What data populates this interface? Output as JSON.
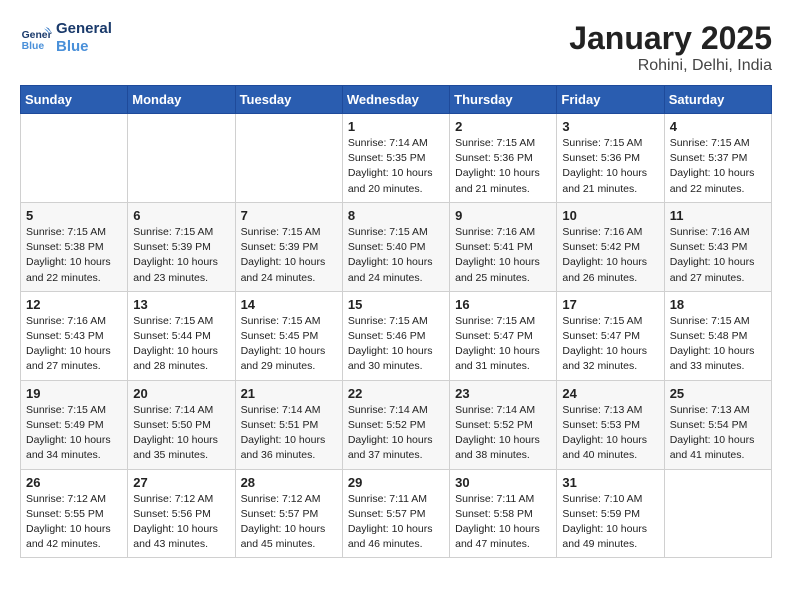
{
  "logo": {
    "line1": "General",
    "line2": "Blue"
  },
  "title": "January 2025",
  "location": "Rohini, Delhi, India",
  "weekdays": [
    "Sunday",
    "Monday",
    "Tuesday",
    "Wednesday",
    "Thursday",
    "Friday",
    "Saturday"
  ],
  "weeks": [
    [
      {
        "day": "",
        "sunrise": "",
        "sunset": "",
        "daylight": ""
      },
      {
        "day": "",
        "sunrise": "",
        "sunset": "",
        "daylight": ""
      },
      {
        "day": "",
        "sunrise": "",
        "sunset": "",
        "daylight": ""
      },
      {
        "day": "1",
        "sunrise": "Sunrise: 7:14 AM",
        "sunset": "Sunset: 5:35 PM",
        "daylight": "Daylight: 10 hours and 20 minutes."
      },
      {
        "day": "2",
        "sunrise": "Sunrise: 7:15 AM",
        "sunset": "Sunset: 5:36 PM",
        "daylight": "Daylight: 10 hours and 21 minutes."
      },
      {
        "day": "3",
        "sunrise": "Sunrise: 7:15 AM",
        "sunset": "Sunset: 5:36 PM",
        "daylight": "Daylight: 10 hours and 21 minutes."
      },
      {
        "day": "4",
        "sunrise": "Sunrise: 7:15 AM",
        "sunset": "Sunset: 5:37 PM",
        "daylight": "Daylight: 10 hours and 22 minutes."
      }
    ],
    [
      {
        "day": "5",
        "sunrise": "Sunrise: 7:15 AM",
        "sunset": "Sunset: 5:38 PM",
        "daylight": "Daylight: 10 hours and 22 minutes."
      },
      {
        "day": "6",
        "sunrise": "Sunrise: 7:15 AM",
        "sunset": "Sunset: 5:39 PM",
        "daylight": "Daylight: 10 hours and 23 minutes."
      },
      {
        "day": "7",
        "sunrise": "Sunrise: 7:15 AM",
        "sunset": "Sunset: 5:39 PM",
        "daylight": "Daylight: 10 hours and 24 minutes."
      },
      {
        "day": "8",
        "sunrise": "Sunrise: 7:15 AM",
        "sunset": "Sunset: 5:40 PM",
        "daylight": "Daylight: 10 hours and 24 minutes."
      },
      {
        "day": "9",
        "sunrise": "Sunrise: 7:16 AM",
        "sunset": "Sunset: 5:41 PM",
        "daylight": "Daylight: 10 hours and 25 minutes."
      },
      {
        "day": "10",
        "sunrise": "Sunrise: 7:16 AM",
        "sunset": "Sunset: 5:42 PM",
        "daylight": "Daylight: 10 hours and 26 minutes."
      },
      {
        "day": "11",
        "sunrise": "Sunrise: 7:16 AM",
        "sunset": "Sunset: 5:43 PM",
        "daylight": "Daylight: 10 hours and 27 minutes."
      }
    ],
    [
      {
        "day": "12",
        "sunrise": "Sunrise: 7:16 AM",
        "sunset": "Sunset: 5:43 PM",
        "daylight": "Daylight: 10 hours and 27 minutes."
      },
      {
        "day": "13",
        "sunrise": "Sunrise: 7:15 AM",
        "sunset": "Sunset: 5:44 PM",
        "daylight": "Daylight: 10 hours and 28 minutes."
      },
      {
        "day": "14",
        "sunrise": "Sunrise: 7:15 AM",
        "sunset": "Sunset: 5:45 PM",
        "daylight": "Daylight: 10 hours and 29 minutes."
      },
      {
        "day": "15",
        "sunrise": "Sunrise: 7:15 AM",
        "sunset": "Sunset: 5:46 PM",
        "daylight": "Daylight: 10 hours and 30 minutes."
      },
      {
        "day": "16",
        "sunrise": "Sunrise: 7:15 AM",
        "sunset": "Sunset: 5:47 PM",
        "daylight": "Daylight: 10 hours and 31 minutes."
      },
      {
        "day": "17",
        "sunrise": "Sunrise: 7:15 AM",
        "sunset": "Sunset: 5:47 PM",
        "daylight": "Daylight: 10 hours and 32 minutes."
      },
      {
        "day": "18",
        "sunrise": "Sunrise: 7:15 AM",
        "sunset": "Sunset: 5:48 PM",
        "daylight": "Daylight: 10 hours and 33 minutes."
      }
    ],
    [
      {
        "day": "19",
        "sunrise": "Sunrise: 7:15 AM",
        "sunset": "Sunset: 5:49 PM",
        "daylight": "Daylight: 10 hours and 34 minutes."
      },
      {
        "day": "20",
        "sunrise": "Sunrise: 7:14 AM",
        "sunset": "Sunset: 5:50 PM",
        "daylight": "Daylight: 10 hours and 35 minutes."
      },
      {
        "day": "21",
        "sunrise": "Sunrise: 7:14 AM",
        "sunset": "Sunset: 5:51 PM",
        "daylight": "Daylight: 10 hours and 36 minutes."
      },
      {
        "day": "22",
        "sunrise": "Sunrise: 7:14 AM",
        "sunset": "Sunset: 5:52 PM",
        "daylight": "Daylight: 10 hours and 37 minutes."
      },
      {
        "day": "23",
        "sunrise": "Sunrise: 7:14 AM",
        "sunset": "Sunset: 5:52 PM",
        "daylight": "Daylight: 10 hours and 38 minutes."
      },
      {
        "day": "24",
        "sunrise": "Sunrise: 7:13 AM",
        "sunset": "Sunset: 5:53 PM",
        "daylight": "Daylight: 10 hours and 40 minutes."
      },
      {
        "day": "25",
        "sunrise": "Sunrise: 7:13 AM",
        "sunset": "Sunset: 5:54 PM",
        "daylight": "Daylight: 10 hours and 41 minutes."
      }
    ],
    [
      {
        "day": "26",
        "sunrise": "Sunrise: 7:12 AM",
        "sunset": "Sunset: 5:55 PM",
        "daylight": "Daylight: 10 hours and 42 minutes."
      },
      {
        "day": "27",
        "sunrise": "Sunrise: 7:12 AM",
        "sunset": "Sunset: 5:56 PM",
        "daylight": "Daylight: 10 hours and 43 minutes."
      },
      {
        "day": "28",
        "sunrise": "Sunrise: 7:12 AM",
        "sunset": "Sunset: 5:57 PM",
        "daylight": "Daylight: 10 hours and 45 minutes."
      },
      {
        "day": "29",
        "sunrise": "Sunrise: 7:11 AM",
        "sunset": "Sunset: 5:57 PM",
        "daylight": "Daylight: 10 hours and 46 minutes."
      },
      {
        "day": "30",
        "sunrise": "Sunrise: 7:11 AM",
        "sunset": "Sunset: 5:58 PM",
        "daylight": "Daylight: 10 hours and 47 minutes."
      },
      {
        "day": "31",
        "sunrise": "Sunrise: 7:10 AM",
        "sunset": "Sunset: 5:59 PM",
        "daylight": "Daylight: 10 hours and 49 minutes."
      },
      {
        "day": "",
        "sunrise": "",
        "sunset": "",
        "daylight": ""
      }
    ]
  ]
}
